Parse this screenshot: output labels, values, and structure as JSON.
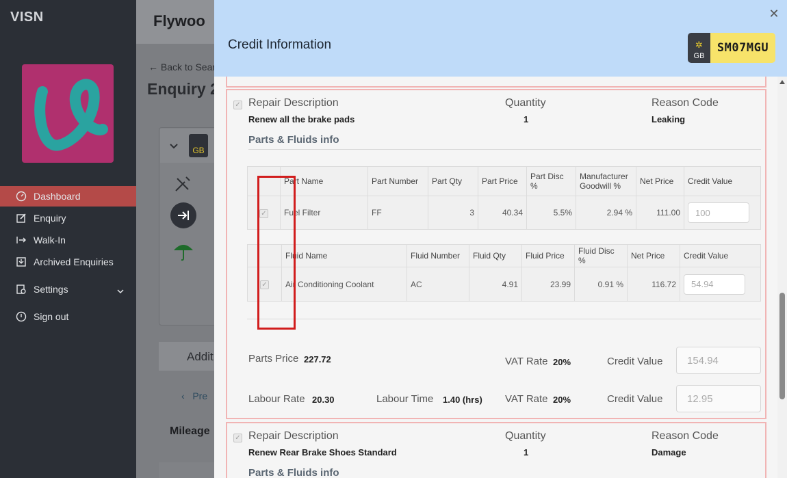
{
  "sidebar": {
    "brand": "VISN",
    "items": [
      {
        "label": "Dashboard",
        "icon": "dashboard-icon",
        "active": true
      },
      {
        "label": "Enquiry",
        "icon": "edit-icon"
      },
      {
        "label": "Walk-In",
        "icon": "walk-in-icon"
      },
      {
        "label": "Archived Enquiries",
        "icon": "archive-icon"
      },
      {
        "label": "Settings",
        "icon": "settings-icon"
      },
      {
        "label": "Sign out",
        "icon": "power-icon"
      }
    ]
  },
  "background": {
    "title": "Flywoo",
    "back_link": "Back to Sear",
    "enquiry_title": "Enquiry 2",
    "gb_mini": "GB",
    "additional_tab": "Addit",
    "prev_link": "Pre",
    "mileage": "Mileage"
  },
  "modal": {
    "title": "Credit Information",
    "plate": {
      "country": "GB",
      "registration": "SM07MGU"
    },
    "repair1": {
      "desc_label": "Repair Description",
      "desc_value": "Renew all the brake pads",
      "qty_label": "Quantity",
      "qty_value": "1",
      "reason_label": "Reason Code",
      "reason_value": "Leaking",
      "pf_title": "Parts & Fluids info",
      "parts_headers": [
        "Part Name",
        "Part Number",
        "Part Qty",
        "Part Price",
        "Part Disc %",
        "Manufacturer Goodwill %",
        "Net Price",
        "Credit Value"
      ],
      "parts_row": {
        "name": "Fuel Filter",
        "number": "FF",
        "qty": "3",
        "price": "40.34",
        "disc": "5.5%",
        "goodwill": "2.94 %",
        "net": "111.00",
        "credit": "100"
      },
      "fluid_headers": [
        "Fluid Name",
        "Fluid Number",
        "Fluid Qty",
        "Fluid Price",
        "Fluid Disc %",
        "Net Price",
        "Credit Value"
      ],
      "fluid_row": {
        "name": "Air Conditioning Coolant",
        "number": "AC",
        "qty": "4.91",
        "price": "23.99",
        "disc": "0.91 %",
        "net": "116.72",
        "credit": "54.94"
      },
      "parts_price_label": "Parts Price",
      "parts_price_value": "227.72",
      "vat_label": "VAT Rate",
      "vat_value": "20%",
      "credit_label": "Credit Value",
      "parts_credit": "154.94",
      "labour_rate_label": "Labour Rate",
      "labour_rate_value": "20.30",
      "labour_time_label": "Labour Time",
      "labour_time_value": "1.40 (hrs)",
      "labour_credit": "12.95"
    },
    "repair2": {
      "desc_label": "Repair Description",
      "desc_value": "Renew Rear Brake Shoes Standard",
      "qty_label": "Quantity",
      "qty_value": "1",
      "reason_label": "Reason Code",
      "reason_value": "Damage",
      "pf_title": "Parts & Fluids info"
    }
  },
  "colors": {
    "sidebar_bg": "#2b2f36",
    "active_item": "#b44a48",
    "modal_header": "#bfdbf9",
    "repair_border": "#f1b4b4",
    "highlight_red": "#d11d1d",
    "plate_yellow": "#f7e36a"
  }
}
